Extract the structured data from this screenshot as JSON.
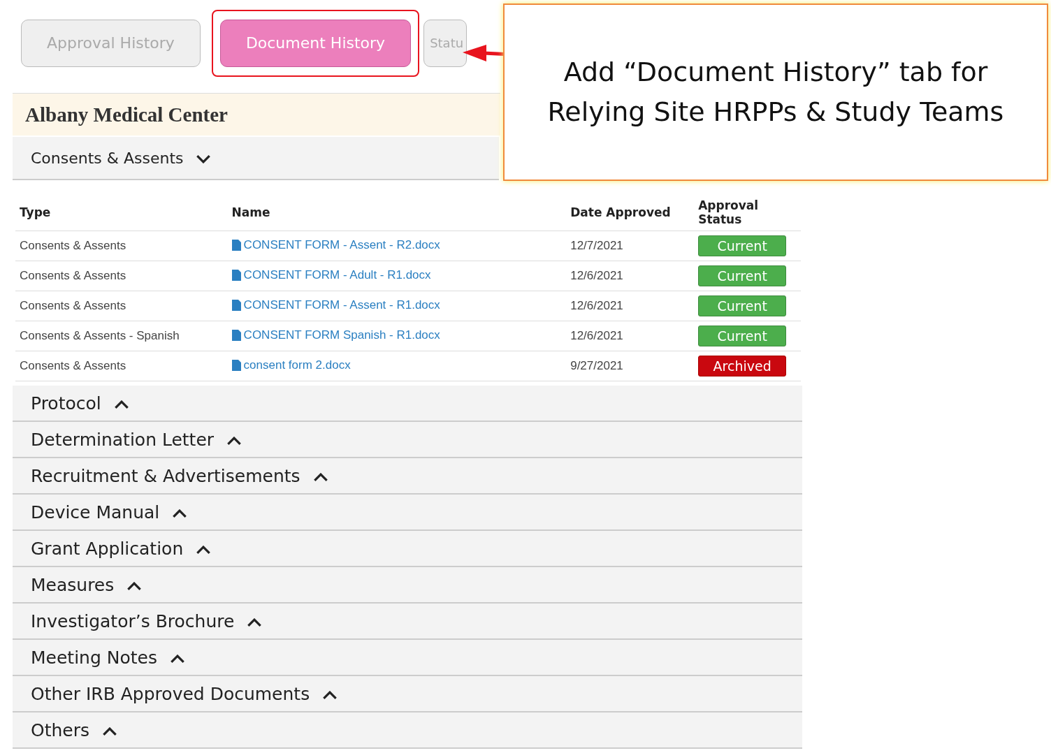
{
  "tabs": [
    {
      "label": "Approval History",
      "selected": false,
      "highlighted": false
    },
    {
      "label": "Document History",
      "selected": true,
      "highlighted": true
    },
    {
      "label": "Statu",
      "selected": false,
      "highlighted": false
    }
  ],
  "site": {
    "title": "Albany Medical Center"
  },
  "open_section": {
    "title": "Consents & Assents",
    "expanded": true
  },
  "table": {
    "columns": [
      "Type",
      "Name",
      "Date Approved",
      "Approval Status"
    ],
    "rows": [
      {
        "type": "Consents & Assents",
        "name": "CONSENT FORM - Assent - R2.docx",
        "date": "12/7/2021",
        "status": "Current",
        "kind": "current"
      },
      {
        "type": "Consents & Assents",
        "name": "CONSENT FORM - Adult - R1.docx",
        "date": "12/6/2021",
        "status": "Current",
        "kind": "current"
      },
      {
        "type": "Consents & Assents",
        "name": "CONSENT FORM - Assent - R1.docx",
        "date": "12/6/2021",
        "status": "Current",
        "kind": "current"
      },
      {
        "type": "Consents & Assents - Spanish",
        "name": "CONSENT FORM Spanish - R1.docx",
        "date": "12/6/2021",
        "status": "Current",
        "kind": "current"
      },
      {
        "type": "Consents & Assents",
        "name": "consent form 2.docx",
        "date": "9/27/2021",
        "status": "Archived",
        "kind": "archived"
      }
    ]
  },
  "sections": [
    {
      "title": "Protocol",
      "expanded": false
    },
    {
      "title": "Determination Letter",
      "expanded": false
    },
    {
      "title": "Recruitment & Advertisements",
      "expanded": false
    },
    {
      "title": "Device Manual",
      "expanded": false
    },
    {
      "title": "Grant Application",
      "expanded": false
    },
    {
      "title": "Measures",
      "expanded": false
    },
    {
      "title": "Investigator’s Brochure",
      "expanded": false
    },
    {
      "title": "Meeting Notes",
      "expanded": false
    },
    {
      "title": "Other IRB Approved Documents",
      "expanded": false
    },
    {
      "title": "Others",
      "expanded": false
    }
  ],
  "callout": {
    "lines": [
      "Add “Document History” tab for",
      "Relying Site HRPPs & Study Teams"
    ]
  }
}
